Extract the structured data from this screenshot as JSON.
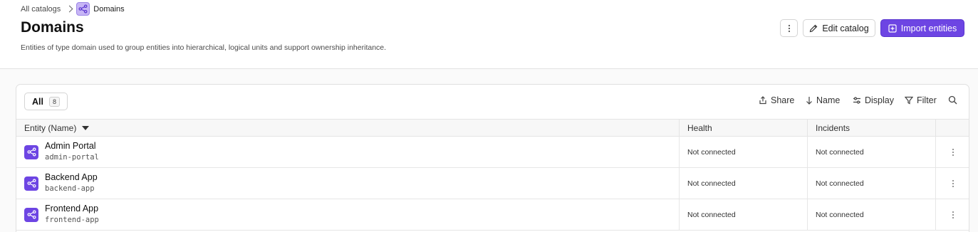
{
  "breadcrumb": {
    "root": "All catalogs",
    "current": "Domains",
    "current_icon": "domain-icon"
  },
  "header": {
    "title": "Domains",
    "description": "Entities of type domain used to group entities into hierarchical, logical units and support ownership inheritance.",
    "more_icon": "vertical-ellipsis-icon",
    "edit_label": "Edit catalog",
    "import_label": "Import entities",
    "accent_color": "#6d45e3"
  },
  "toolbar": {
    "tab_all_label": "All",
    "tab_all_count": "8",
    "share_label": "Share",
    "name_label": "Name",
    "display_label": "Display",
    "filter_label": "Filter"
  },
  "table": {
    "columns": [
      "Entity (Name)",
      "Health",
      "Incidents"
    ],
    "rows": [
      {
        "name": "Admin Portal",
        "id": "admin-portal",
        "health": "Not connected",
        "incidents": "Not connected"
      },
      {
        "name": "Backend App",
        "id": "backend-app",
        "health": "Not connected",
        "incidents": "Not connected"
      },
      {
        "name": "Frontend App",
        "id": "frontend-app",
        "health": "Not connected",
        "incidents": "Not connected"
      }
    ]
  }
}
